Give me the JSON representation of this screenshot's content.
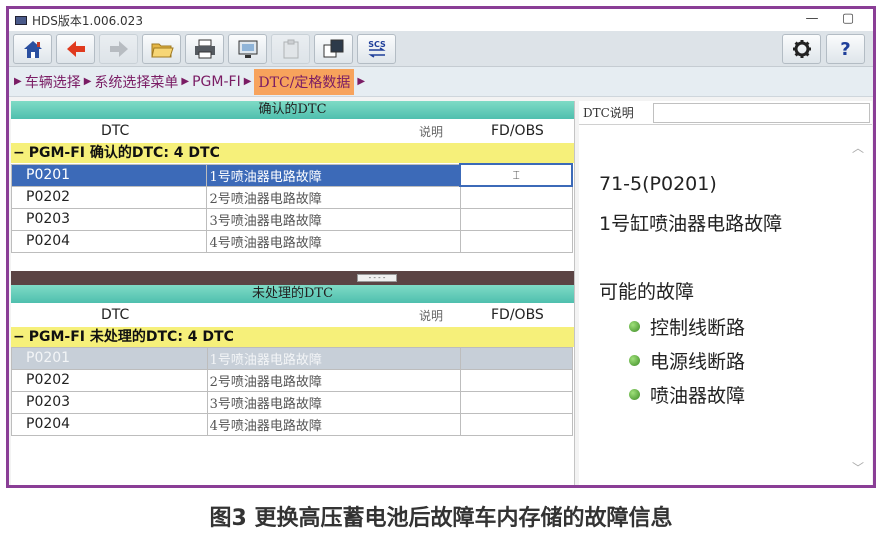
{
  "window": {
    "title": "HDS版本1.006.023",
    "min_label": "—",
    "max_label": "▢"
  },
  "toolbar": {
    "buttons": [
      {
        "name": "home-icon",
        "enabled": true
      },
      {
        "name": "back-arrow-icon",
        "enabled": true
      },
      {
        "name": "forward-arrow-icon",
        "enabled": false
      },
      {
        "name": "folder-icon",
        "enabled": true
      },
      {
        "name": "printer-icon",
        "enabled": true
      },
      {
        "name": "save-screen-icon",
        "enabled": true
      },
      {
        "name": "clipboard-icon",
        "enabled": false
      },
      {
        "name": "copy-window-icon",
        "enabled": true
      },
      {
        "name": "scs-icon",
        "enabled": true,
        "text": "SCS"
      }
    ],
    "settings_icon": "gear-icon",
    "help_label": "?"
  },
  "breadcrumb": {
    "items": [
      "车辆选择",
      "系统选择菜单",
      "PGM-FI",
      "DTC/定格数据"
    ],
    "active_index": 3
  },
  "confirmed": {
    "header": "确认的DTC",
    "columns": {
      "dtc": "DTC",
      "desc": "说明",
      "fd": "FD/OBS"
    },
    "group": "PGM-FI 确认的DTC:  4 DTC",
    "rows": [
      {
        "code": "P0201",
        "desc": "1号喷油器电路故障",
        "fd": "⌶"
      },
      {
        "code": "P0202",
        "desc": "2号喷油器电路故障",
        "fd": ""
      },
      {
        "code": "P0203",
        "desc": "3号喷油器电路故障",
        "fd": ""
      },
      {
        "code": "P0204",
        "desc": "4号喷油器电路故障",
        "fd": ""
      }
    ]
  },
  "pending": {
    "header": "未处理的DTC",
    "columns": {
      "dtc": "DTC",
      "desc": "说明",
      "fd": "FD/OBS"
    },
    "group": "PGM-FI 未处理的DTC:  4 DTC",
    "rows": [
      {
        "code": "P0201",
        "desc": "1号喷油器电路故障",
        "fd": ""
      },
      {
        "code": "P0202",
        "desc": "2号喷油器电路故障",
        "fd": ""
      },
      {
        "code": "P0203",
        "desc": "3号喷油器电路故障",
        "fd": ""
      },
      {
        "code": "P0204",
        "desc": "4号喷油器电路故障",
        "fd": ""
      }
    ]
  },
  "splitter_grip": "- - - -",
  "detail": {
    "label": "DTC说明",
    "code_line": "71-5(P0201)",
    "name_line": "1号缸喷油器电路故障",
    "causes_title": "可能的故障",
    "causes": [
      "控制线断路",
      "电源线断路",
      "喷油器故障"
    ],
    "scroll_up": "︿",
    "scroll_down": "﹀"
  },
  "caption": "图3 更换高压蓄电池后故障车内存储的故障信息",
  "colors": {
    "frame": "#8a3e96",
    "section_header": "#4fbfae",
    "group_row": "#f6f07a",
    "selected_row": "#3c6ab8",
    "breadcrumb_active": "#f7a35c",
    "bullet": "#3c8a25"
  }
}
